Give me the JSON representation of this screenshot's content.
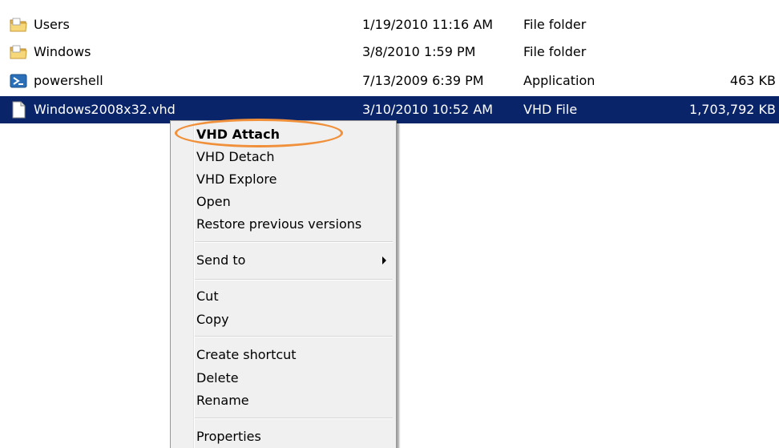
{
  "files": [
    {
      "name": "Users",
      "date": "1/19/2010 11:16 AM",
      "type": "File folder",
      "size": "",
      "icon": "folder-icon"
    },
    {
      "name": "Windows",
      "date": "3/8/2010 1:59 PM",
      "type": "File folder",
      "size": "",
      "icon": "folder-icon"
    },
    {
      "name": "powershell",
      "date": "7/13/2009 6:39 PM",
      "type": "Application",
      "size": "463 KB",
      "icon": "powershell-icon"
    },
    {
      "name": "Windows2008x32.vhd",
      "date": "3/10/2010 10:52 AM",
      "type": "VHD File",
      "size": "1,703,792 KB",
      "icon": "file-icon",
      "selected": true
    }
  ],
  "context_menu": {
    "items": [
      {
        "label": "VHD Attach",
        "bold": true
      },
      {
        "label": "VHD Detach"
      },
      {
        "label": "VHD Explore"
      },
      {
        "label": "Open"
      },
      {
        "label": "Restore previous versions"
      },
      {
        "label": "Send to",
        "submenu": true
      },
      {
        "label": "Cut"
      },
      {
        "label": "Copy"
      },
      {
        "label": "Create shortcut"
      },
      {
        "label": "Delete"
      },
      {
        "label": "Rename"
      },
      {
        "label": "Properties"
      }
    ]
  },
  "colors": {
    "selection": "#0a246a",
    "highlight_ring": "#f0903a",
    "menu_background": "#f0f0f0"
  }
}
